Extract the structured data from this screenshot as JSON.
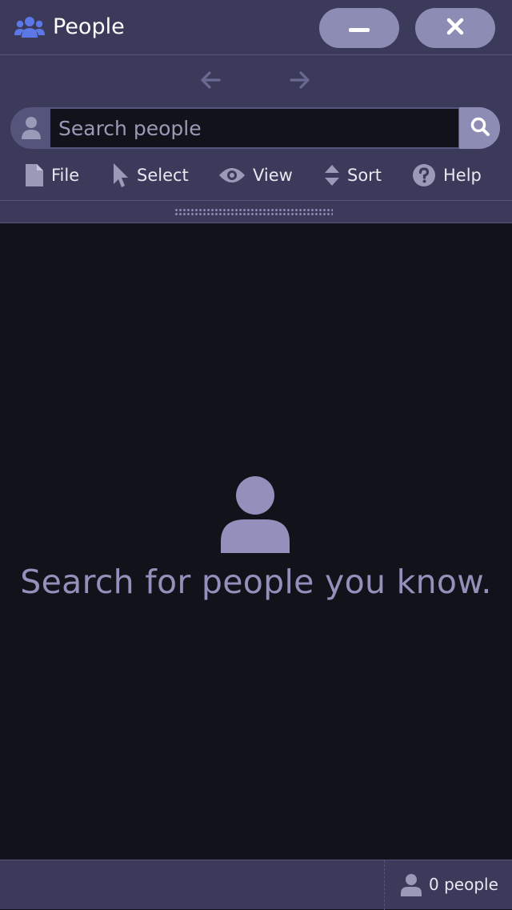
{
  "window": {
    "title": "People",
    "app_icon": "users-icon",
    "minimize_icon": "minimize-icon",
    "close_icon": "close-icon"
  },
  "nav": {
    "back_icon": "arrow-left-icon",
    "forward_icon": "arrow-right-icon"
  },
  "search": {
    "placeholder": "Search people",
    "value": "",
    "leading_icon": "person-icon",
    "button_icon": "search-icon"
  },
  "menu": {
    "items": [
      {
        "label": "File",
        "icon": "file-icon"
      },
      {
        "label": "Select",
        "icon": "cursor-icon"
      },
      {
        "label": "View",
        "icon": "eye-icon"
      },
      {
        "label": "Sort",
        "icon": "sort-icon"
      },
      {
        "label": "Help",
        "icon": "help-icon"
      }
    ]
  },
  "empty_state": {
    "icon": "person-icon",
    "message": "Search for people you know."
  },
  "status": {
    "icon": "person-icon",
    "count_text": "0 people"
  },
  "colors": {
    "chrome": "#3b3a5a",
    "border": "#55547a",
    "accent": "#8c8cb4",
    "content_bg": "#12121a",
    "muted_text": "#9390bc",
    "app_icon": "#5b78e6"
  }
}
